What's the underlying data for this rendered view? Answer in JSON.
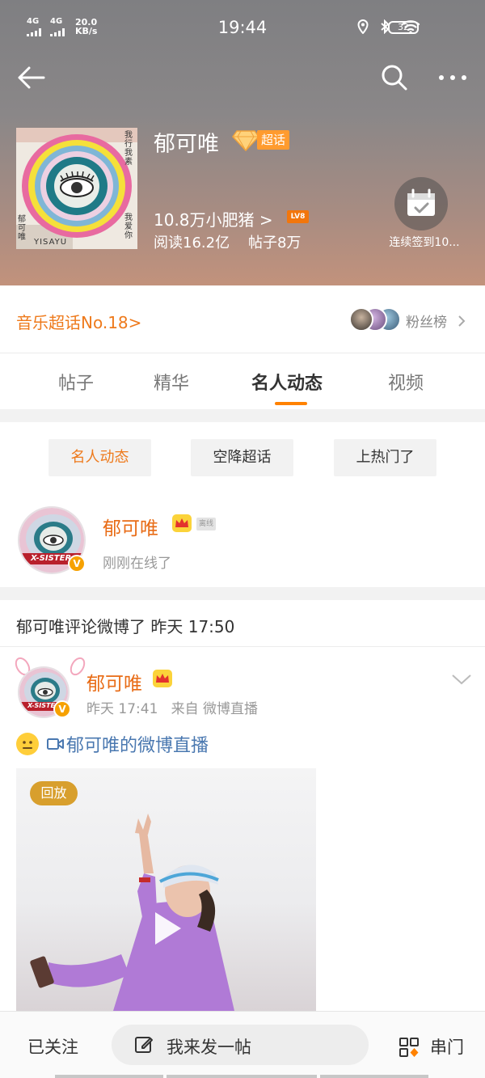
{
  "status_bar": {
    "signal1": "4G",
    "signal2": "4G",
    "net_speed": "20.0",
    "net_unit": "KB/s",
    "time": "19:44",
    "battery": "32"
  },
  "header": {
    "topic_name": "郁可唯",
    "super_badge": "超话",
    "fans_line": "10.8万小肥猪 >",
    "level": "LV8",
    "stats": "阅读16.2亿    帖子8万",
    "checkin_label": "连续签到10..."
  },
  "rank": {
    "label": "音乐超话No.18>",
    "fan_rank_label": "粉丝榜"
  },
  "tabs": [
    "帖子",
    "精华",
    "名人动态",
    "视频"
  ],
  "active_tab": "名人动态",
  "filters": [
    "名人动态",
    "空降超话",
    "上热门了"
  ],
  "profile": {
    "name": "郁可唯",
    "offline": "离线",
    "online_text": "刚刚在线了"
  },
  "activity": "郁可唯评论微博了  昨天 17:50",
  "post": {
    "author": "郁可唯",
    "meta": "昨天 17:41   来自 微博直播",
    "content": "郁可唯的微博直播",
    "replay": "回放"
  },
  "bottom": {
    "followed": "已关注",
    "compose": "我来发一帖",
    "chuanmen": "串门"
  },
  "cover_text": {
    "yisa": "YISAYU",
    "right_top": "我行我素",
    "right_bottom": "我爱你",
    "left_vertical": "郁可唯"
  },
  "avatar_text": "X-SISTER",
  "colors": {
    "orange": "#ee7a1c",
    "link_blue": "#4a78b0",
    "gold": "#d89f2d"
  }
}
